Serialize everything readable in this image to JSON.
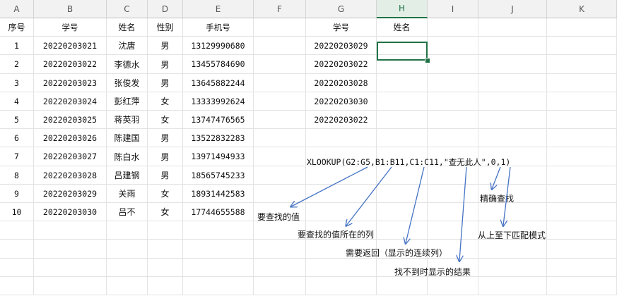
{
  "columns": [
    "A",
    "B",
    "C",
    "D",
    "E",
    "F",
    "G",
    "H",
    "I",
    "J",
    "K"
  ],
  "selected_column": "H",
  "header_row": {
    "A": "序号",
    "B": "学号",
    "C": "姓名",
    "D": "性别",
    "E": "手机号",
    "G": "学号",
    "H": "姓名"
  },
  "rows": [
    {
      "A": "1",
      "B": "20220203021",
      "C": "沈唐",
      "D": "男",
      "E": "13129990680",
      "G": "20220203029"
    },
    {
      "A": "2",
      "B": "20220203022",
      "C": "李德水",
      "D": "男",
      "E": "13455784690",
      "G": "20220203022"
    },
    {
      "A": "3",
      "B": "20220203023",
      "C": "张俊发",
      "D": "男",
      "E": "13645882244",
      "G": "20220203028"
    },
    {
      "A": "4",
      "B": "20220203024",
      "C": "彭红萍",
      "D": "女",
      "E": "13333992624",
      "G": "20220203030"
    },
    {
      "A": "5",
      "B": "20220203025",
      "C": "蒋英羽",
      "D": "女",
      "E": "13747476565",
      "G": "20220203022"
    },
    {
      "A": "6",
      "B": "20220203026",
      "C": "陈建国",
      "D": "男",
      "E": "13522832283"
    },
    {
      "A": "7",
      "B": "20220203027",
      "C": "陈白水",
      "D": "男",
      "E": "13971494933"
    },
    {
      "A": "8",
      "B": "20220203028",
      "C": "吕建钢",
      "D": "男",
      "E": "18565745233"
    },
    {
      "A": "9",
      "B": "20220203029",
      "C": "关雨",
      "D": "女",
      "E": "18931442583"
    },
    {
      "A": "10",
      "B": "20220203030",
      "C": "吕不",
      "D": "女",
      "E": "17744655588"
    }
  ],
  "annotations": {
    "formula": "XLOOKUP(G2:G5,B1:B11,C1:C11,\"查无此人\",0,1)",
    "lookup_value": "要查找的值",
    "lookup_array": "要查找的值所在的列",
    "return_array": "需要返回（显示的连续列）",
    "if_not_found": "找不到时显示的结果",
    "match_mode": "精确查找",
    "search_mode": "从上至下匹配模式"
  },
  "colors": {
    "selection": "#217346",
    "arrow": "#4472c4"
  }
}
